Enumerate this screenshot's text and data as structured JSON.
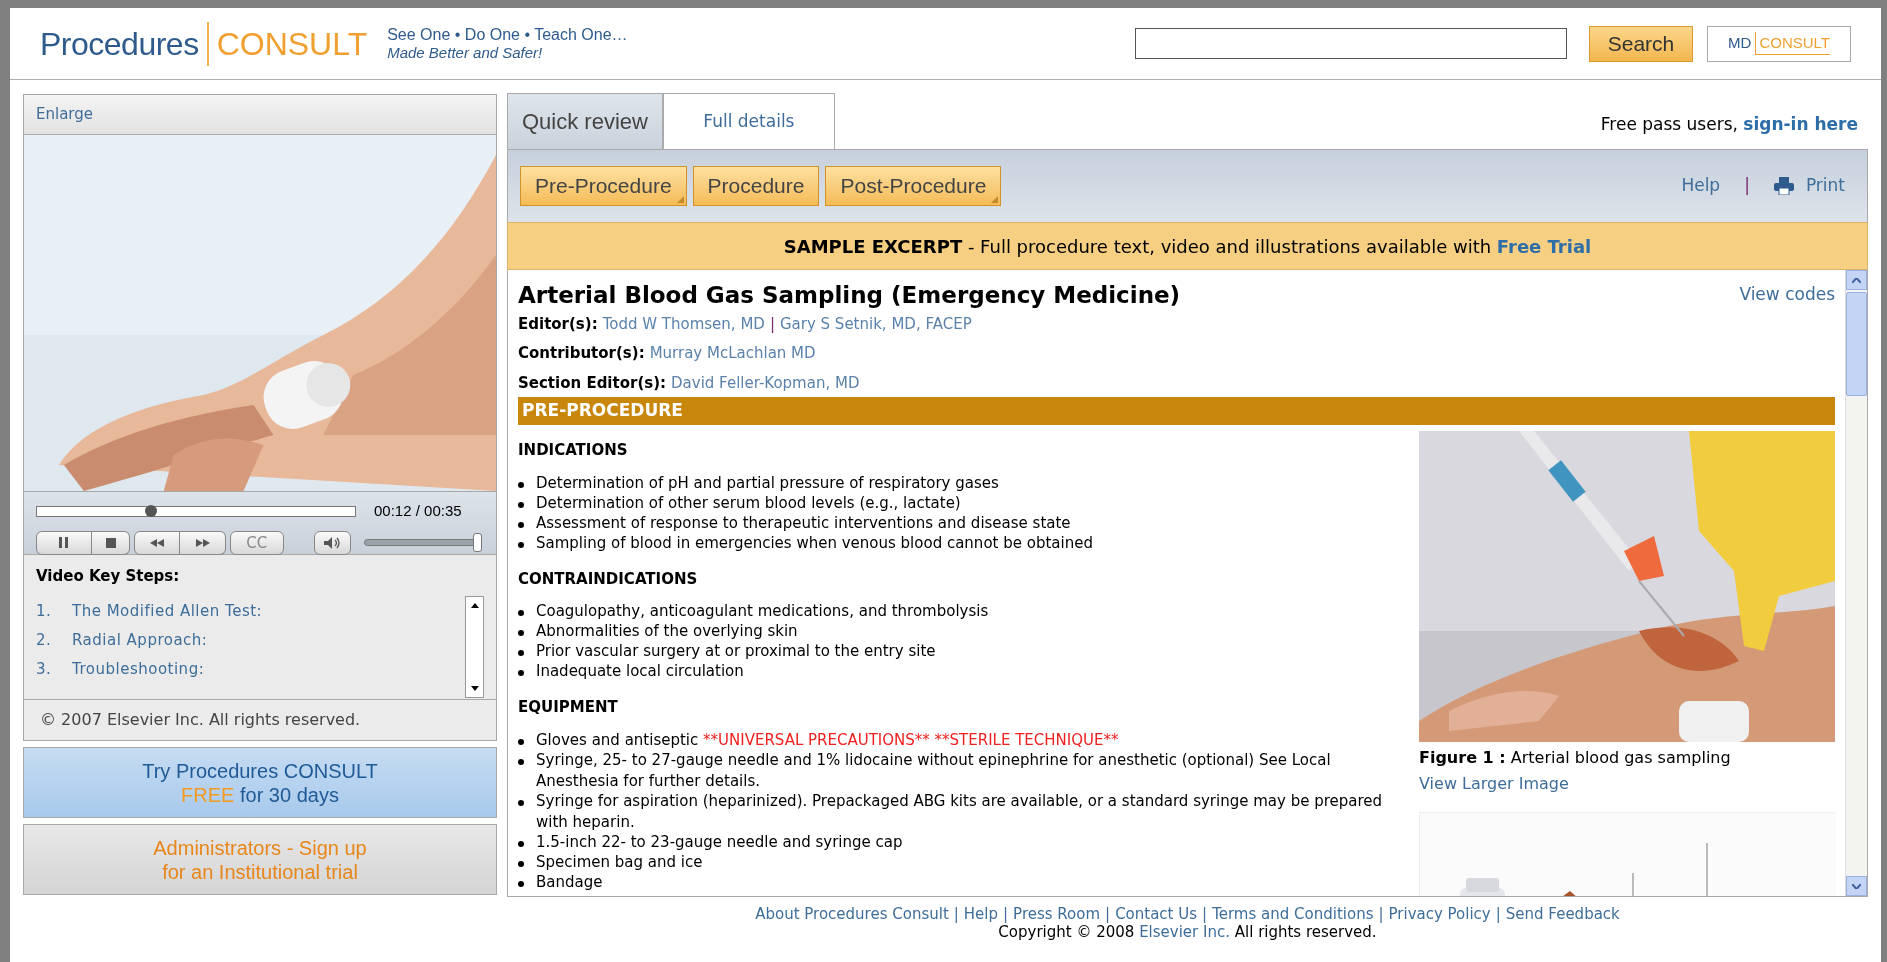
{
  "header": {
    "logo": {
      "word": "Procedures",
      "brand": "CONSULT"
    },
    "tagline": {
      "line1": "See One • Do One • Teach One…",
      "line2": "Made Better and Safer!"
    },
    "search_button": "Search",
    "partner_logo": {
      "word": "MD",
      "brand": "CONSULT"
    }
  },
  "left": {
    "enlarge": "Enlarge",
    "player": {
      "progress": {
        "level": 0.36
      },
      "time": "00:12 / 00:35",
      "cc": "CC",
      "volume": {
        "level": 0.98
      }
    },
    "key_steps": {
      "title": "Video Key Steps:",
      "items": [
        {
          "number": "1.",
          "label": "The Modified Allen Test:"
        },
        {
          "number": "2.",
          "label": "Radial Approach:"
        },
        {
          "number": "3.",
          "label": "Troubleshooting:"
        }
      ]
    },
    "copyright": "© 2007 Elsevier Inc. All rights reserved.",
    "ads": [
      {
        "line1": "Try Procedures CONSULT",
        "highlight": "FREE",
        "line2": "for 30 days",
        "kind": "trial"
      },
      {
        "line1": "Administrators - Sign up",
        "line2": "for an Institutional trial",
        "kind": "admin"
      }
    ]
  },
  "tabs": [
    {
      "label": "Quick review",
      "selected": true
    },
    {
      "label": "Full details",
      "selected": false
    }
  ],
  "free_pass": {
    "text": "Free pass users,",
    "link": "sign-in here"
  },
  "toolbar": {
    "buttons": [
      {
        "label": "Pre-Procedure",
        "has_menu": true
      },
      {
        "label": "Procedure",
        "has_menu": false
      },
      {
        "label": "Post-Procedure",
        "has_menu": true
      }
    ],
    "help": "Help",
    "separator": "|",
    "print": "Print"
  },
  "banner": {
    "text": "**SAMPLE EXCERPT** - Full procedure text, video and illustrations available with",
    "link": "Free Trial"
  },
  "article": {
    "title": "Arterial Blood Gas Sampling (Emergency Medicine)",
    "view_codes": "View codes",
    "credits": [
      {
        "label": "Editor(s):",
        "names": [
          "Todd W Thomsen, MD",
          "Gary S Setnik, MD, FACEP"
        ]
      },
      {
        "label": "Contributor(s):",
        "names": [
          "Murray McLachlan MD"
        ]
      },
      {
        "label": "Section Editor(s):",
        "names": [
          "David Feller-Kopman, MD"
        ]
      }
    ],
    "credit_separator": "|",
    "section": "PRE-PROCEDURE",
    "subsections": [
      {
        "heading": "INDICATIONS",
        "items": [
          {
            "text": "Determination of pH and partial pressure of respiratory gases"
          },
          {
            "text": "Determination of other serum blood levels (e.g., lactate)"
          },
          {
            "text": "Assessment of response to therapeutic interventions and disease state"
          },
          {
            "text": "Sampling of blood in emergencies when venous blood cannot be obtained"
          }
        ]
      },
      {
        "heading": "CONTRAINDICATIONS",
        "items": [
          {
            "text": "Coagulopathy, anticoagulant medications, and thrombolysis"
          },
          {
            "text": "Abnormalities of the overlying skin"
          },
          {
            "text": "Prior vascular surgery at or proximal to the entry site"
          },
          {
            "text": "Inadequate local circulation"
          }
        ]
      },
      {
        "heading": "EQUIPMENT",
        "items": [
          {
            "text": "Gloves and antiseptic",
            "alert": "**UNIVERSAL PRECAUTIONS** **STERILE TECHNIQUE**"
          },
          {
            "text": "Syringe, 25- to 27-gauge needle and 1% lidocaine without epinephrine for anesthetic (optional) See Local Anesthesia for further details."
          },
          {
            "text": "Syringe for aspiration (heparinized). Prepackaged ABG kits are available, or a standard syringe may be prepared with heparin."
          },
          {
            "text": "1.5-inch 22- to 23-gauge needle and syringe cap"
          },
          {
            "text": "Specimen bag and ice"
          },
          {
            "text": "Bandage"
          }
        ]
      }
    ],
    "figure": {
      "label": "Figure 1 :",
      "caption": "Arterial blood gas sampling",
      "link": "View Larger Image"
    }
  },
  "footer": {
    "links": [
      "About Procedures Consult",
      "Help",
      "Press Room",
      "Contact Us",
      "Terms and Conditions",
      "Privacy Policy",
      "Send Feedback"
    ],
    "separator": "|",
    "copyright": {
      "before": "Copyright © 2008",
      "link": "Elsevier Inc.",
      "after": "All rights reserved."
    }
  }
}
